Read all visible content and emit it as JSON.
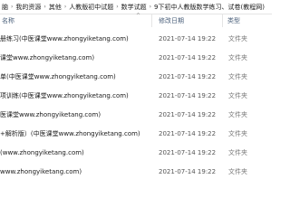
{
  "breadcrumb": [
    "脑",
    "我的资源",
    "其他",
    "人教版初中试题",
    "数学试题",
    "9下初中人教版数学练习、试卷(教程网)"
  ],
  "columns": {
    "name": "名称",
    "date": "修改日期",
    "type": "类型"
  },
  "files": [
    {
      "name": "册练习(中医课堂www.zhongyiketang.com)",
      "date": "2021-07-14 19:22",
      "type": "文件夹"
    },
    {
      "name": "课堂www.zhongyiketang.com)",
      "date": "2021-07-14 19:22",
      "type": "文件夹"
    },
    {
      "name": "单(中医课堂www.zhongyiketang.com)",
      "date": "2021-07-14 19:22",
      "type": "文件夹"
    },
    {
      "name": "项训练(中医课堂www.zhongyiketang.com)",
      "date": "2021-07-14 19:22",
      "type": "文件夹"
    },
    {
      "name": "医课堂www.zhongyiketang.com)",
      "date": "2021-07-14 19:22",
      "type": "文件夹"
    },
    {
      "name": "+解析版）(中医课堂www.zhongyiketang.com)",
      "date": "2021-07-14 19:22",
      "type": "文件夹"
    },
    {
      "name": "(www.zhongyiketang.com)",
      "date": "2021-07-14 19:22",
      "type": "文件夹"
    },
    {
      "name": "www.zhongyiketang.com)",
      "date": "2021-07-14 19:22",
      "type": "文件夹"
    }
  ]
}
